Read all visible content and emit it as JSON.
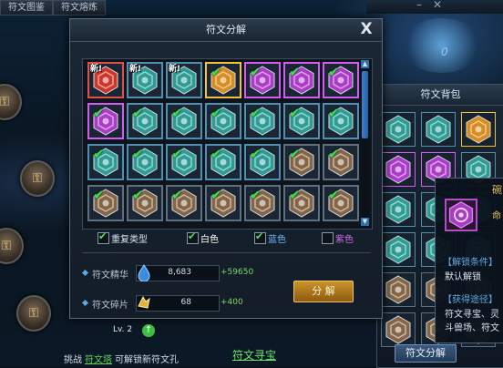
{
  "top_tabs": [
    "符文图鉴",
    "符文熔炼"
  ],
  "dialog": {
    "title": "符文分解",
    "close_label": "X",
    "grid": [
      [
        {
          "color": "red",
          "new": true,
          "checked": false
        },
        {
          "color": "teal",
          "new": true,
          "checked": false
        },
        {
          "color": "teal",
          "new": true,
          "checked": false
        },
        {
          "color": "orange",
          "new": false,
          "checked": true
        },
        {
          "color": "purple",
          "new": false,
          "checked": true
        },
        {
          "color": "purple",
          "new": false,
          "checked": true
        },
        {
          "color": "purple",
          "new": false,
          "checked": true
        }
      ],
      [
        {
          "color": "purple",
          "new": false,
          "checked": true
        },
        {
          "color": "teal",
          "new": false,
          "checked": true
        },
        {
          "color": "teal",
          "new": false,
          "checked": true
        },
        {
          "color": "teal",
          "new": false,
          "checked": true
        },
        {
          "color": "teal",
          "new": false,
          "checked": true
        },
        {
          "color": "teal",
          "new": false,
          "checked": true
        },
        {
          "color": "teal",
          "new": false,
          "checked": true
        }
      ],
      [
        {
          "color": "teal",
          "new": false,
          "checked": true
        },
        {
          "color": "teal",
          "new": false,
          "checked": true
        },
        {
          "color": "teal",
          "new": false,
          "checked": true
        },
        {
          "color": "teal",
          "new": false,
          "checked": true
        },
        {
          "color": "teal",
          "new": false,
          "checked": true
        },
        {
          "color": "brown",
          "new": false,
          "checked": true
        },
        {
          "color": "brown",
          "new": false,
          "checked": true
        }
      ],
      [
        {
          "color": "brown",
          "new": false,
          "checked": true
        },
        {
          "color": "brown",
          "new": false,
          "checked": true
        },
        {
          "color": "brown",
          "new": false,
          "checked": true
        },
        {
          "color": "brown",
          "new": false,
          "checked": true
        },
        {
          "color": "brown",
          "new": false,
          "checked": true
        },
        {
          "color": "brown",
          "new": false,
          "checked": true
        },
        {
          "color": "brown",
          "new": false,
          "checked": true
        }
      ]
    ],
    "new_label": "新!",
    "filters": [
      {
        "label": "重复类型",
        "checked": true,
        "color": "#d7e3ee"
      },
      {
        "label": "白色",
        "checked": true,
        "color": "#ffffff"
      },
      {
        "label": "蓝色",
        "checked": true,
        "color": "#6fb6ff"
      },
      {
        "label": "紫色",
        "checked": false,
        "color": "#c86ee8"
      }
    ],
    "essence": {
      "label": "符文精华",
      "value": "8,683",
      "gain": "+59650"
    },
    "fragment": {
      "label": "符文碎片",
      "value": "68",
      "gain": "+400"
    },
    "decompose_button": "分  解"
  },
  "bag": {
    "title": "符文背包",
    "button": "符文分解"
  },
  "tooltip": {
    "side_char_top": "碗",
    "side_char_mid": "命",
    "unlock_header": "【解锁条件】",
    "unlock_text": "默认解锁",
    "obtain_header": "【获得途径】",
    "obtain_line1": "符文寻宝、灵",
    "obtain_line2": "斗兽场、符文"
  },
  "bottom": {
    "level": "Lv. 2",
    "hint_prefix": "挑战",
    "hint_link": "符文塔",
    "hint_suffix": "可解锁新符文孔",
    "treasure_link": "符文寻宝"
  },
  "bg_number": "0",
  "colors": {
    "red": "#d8372c",
    "teal": "#2fa39a",
    "orange": "#e3921f",
    "purple": "#b43ed0",
    "brown": "#8a6a48",
    "accent": "#e3b24a",
    "green": "#39e34a"
  }
}
